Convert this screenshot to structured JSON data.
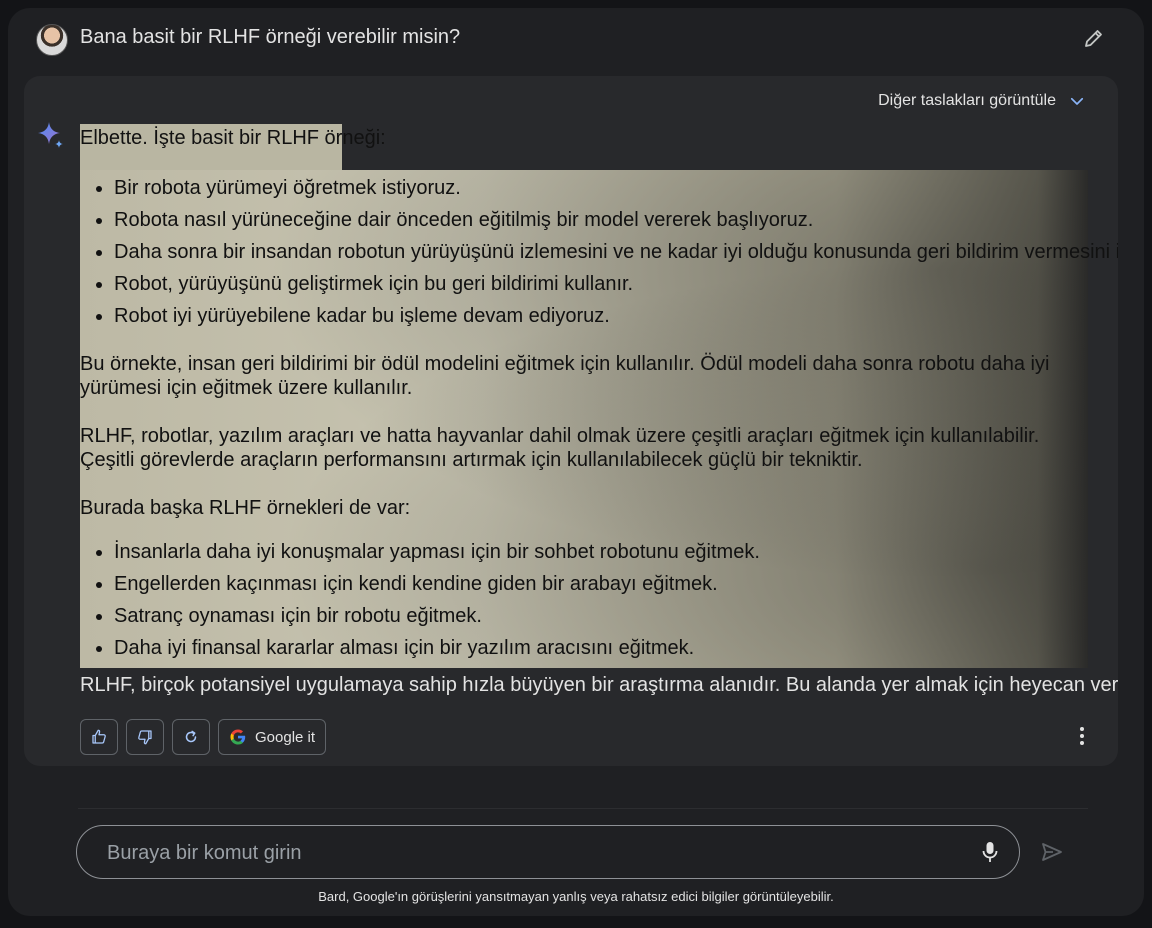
{
  "prompt": {
    "text": "Bana basit bir RLHF örneği verebilir misin?"
  },
  "drafts": {
    "label": "Diğer taslakları görüntüle"
  },
  "response": {
    "intro": "Elbette. İşte basit bir RLHF örneği:",
    "steps": [
      "Bir robota yürümeyi öğretmek istiyoruz.",
      "Robota nasıl yürüneceğine dair önceden eğitilmiş bir model vererek başlıyoruz.",
      "Daha sonra bir insandan robotun yürüyüşünü izlemesini ve ne kadar iyi olduğu konusunda geri bildirim vermesini istiyoruz.",
      "Robot, yürüyüşünü geliştirmek için bu geri bildirimi kullanır.",
      "Robot iyi yürüyebilene kadar bu işleme devam ediyoruz."
    ],
    "paragraph1": "Bu örnekte, insan geri bildirimi bir ödül modelini eğitmek için kullanılır. Ödül modeli daha sonra robotu daha iyi yürümesi için eğitmek üzere kullanılır.",
    "paragraph2": "RLHF, robotlar, yazılım araçları ve hatta hayvanlar dahil olmak üzere çeşitli araçları eğitmek için kullanılabilir. Çeşitli görevlerde araçların performansını artırmak için kullanılabilecek güçlü bir tekniktir.",
    "paragraph3": "Burada başka RLHF örnekleri de var:",
    "examples": [
      "İnsanlarla daha iyi konuşmalar yapması için bir sohbet robotunu eğitmek.",
      "Engellerden kaçınması için kendi kendine giden bir arabayı eğitmek.",
      "Satranç oynaması için bir robotu eğitmek.",
      "Daha iyi finansal kararlar alması için bir yazılım aracısını eğitmek."
    ],
    "closing": "RLHF, birçok potansiyel uygulamaya sahip hızla büyüyen bir araştırma alanıdır. Bu alanda yer almak için heyecan verici bir zaman!"
  },
  "actions": {
    "google_label": "Google it"
  },
  "input": {
    "placeholder": "Buraya bir komut girin"
  },
  "footer": {
    "disclaimer": "Bard, Google'ın görüşlerini yansıtmayan yanlış veya rahatsız edici bilgiler görüntüleyebilir."
  },
  "colors": {
    "background": "#131417",
    "panel": "#1f2023",
    "card": "#28292c",
    "highlight": "#c7c4b1",
    "accent_blue": "#8ab4f8"
  }
}
